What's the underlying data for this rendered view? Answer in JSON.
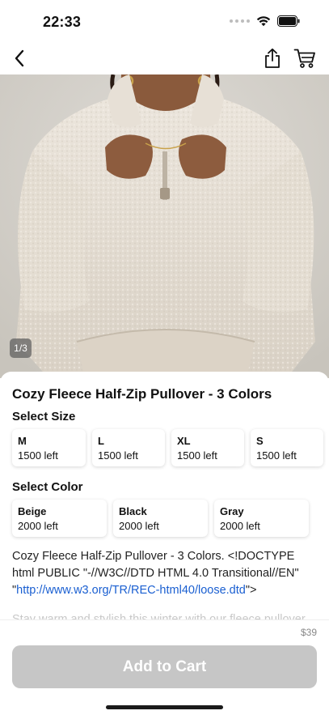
{
  "status_bar": {
    "time": "22:33",
    "icons": [
      "signal-dots-icon",
      "wifi-icon",
      "battery-icon"
    ]
  },
  "nav": {
    "back_icon": "chevron-left-icon",
    "share_icon": "share-icon",
    "cart_icon": "cart-icon"
  },
  "gallery": {
    "counter": "1/3"
  },
  "product": {
    "title": "Cozy Fleece Half-Zip Pullover - 3 Colors",
    "size_label": "Select Size",
    "sizes": [
      {
        "name": "M",
        "stock": "1500 left"
      },
      {
        "name": "L",
        "stock": "1500 left"
      },
      {
        "name": "XL",
        "stock": "1500 left"
      },
      {
        "name": "S",
        "stock": "1500 left"
      }
    ],
    "color_label": "Select Color",
    "colors": [
      {
        "name": "Beige",
        "stock": "2000 left"
      },
      {
        "name": "Black",
        "stock": "2000 left"
      },
      {
        "name": "Gray",
        "stock": "2000 left"
      }
    ],
    "description_text": "Cozy Fleece Half-Zip Pullover - 3 Colors. <!DOCTYPE html PUBLIC \"-//W3C//DTD HTML 4.0 Transitional//EN\" \"",
    "description_link": "http://www.w3.org/TR/REC-html40/loose.dtd",
    "description_end": "\">",
    "description_fade": "Stay warm and stylish this winter with our fleece pullover"
  },
  "footer": {
    "price": "$39",
    "add_to_cart": "Add to Cart"
  },
  "colors": {
    "button_disabled": "#c6c6c6",
    "link": "#1a5fd1"
  }
}
